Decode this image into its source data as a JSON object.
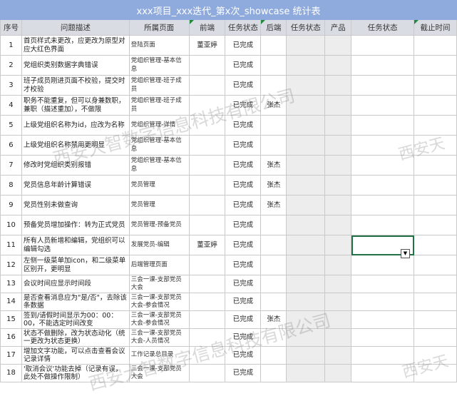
{
  "sheet": {
    "title": "xxx项目_xxx迭代_第x次_showcase 统计表",
    "headers": [
      "序号",
      "问题描述",
      "所属页面",
      "前端",
      "任务状态",
      "后端",
      "任务状态",
      "产品",
      "任务状态",
      "截止时间"
    ],
    "rows": [
      {
        "no": "1",
        "desc": "首页样式未更改，应更改为原型对应大红色界面",
        "page": "登陆页面",
        "fe": "董亚婷",
        "fs": "已完成",
        "be": "",
        "bs": "",
        "pm": "",
        "ps": "",
        "due": ""
      },
      {
        "no": "2",
        "desc": "党组织类别数据字典错误",
        "page": "党组织管理-基本信息",
        "fe": "",
        "fs": "已完成",
        "be": "",
        "bs": "",
        "pm": "",
        "ps": "",
        "due": ""
      },
      {
        "no": "3",
        "desc": "班子成员刚进页面不校验，提交时才校验",
        "page": "党组织管理-班子成员",
        "fe": "",
        "fs": "已完成",
        "be": "",
        "bs": "",
        "pm": "",
        "ps": "",
        "due": ""
      },
      {
        "no": "4",
        "desc": "职务不能重复，但可以身兼数职，兼职（描述重加），不做限",
        "page": "党组织管理-班子成员",
        "fe": "",
        "fs": "已完成",
        "be": "张杰",
        "bs": "",
        "pm": "",
        "ps": "",
        "due": ""
      },
      {
        "no": "5",
        "desc": "上级党组织名称为id，应改为名称",
        "page": "党组织管理-详情",
        "fe": "",
        "fs": "已完成",
        "be": "",
        "bs": "",
        "pm": "",
        "ps": "",
        "due": ""
      },
      {
        "no": "6",
        "desc": "上级党组织名称禁用更明显",
        "page": "党组织管理-基本信息",
        "fe": "",
        "fs": "已完成",
        "be": "",
        "bs": "",
        "pm": "",
        "ps": "",
        "due": ""
      },
      {
        "no": "7",
        "desc": "修改时党组织类别报错",
        "page": "党组织管理-基本信息",
        "fe": "",
        "fs": "已完成",
        "be": "张杰",
        "bs": "",
        "pm": "",
        "ps": "",
        "due": ""
      },
      {
        "no": "8",
        "desc": "党员信息年龄计算错误",
        "page": "党员管理",
        "fe": "",
        "fs": "已完成",
        "be": "张杰",
        "bs": "",
        "pm": "",
        "ps": "",
        "due": ""
      },
      {
        "no": "9",
        "desc": "党员性别未做查询",
        "page": "党员管理",
        "fe": "",
        "fs": "已完成",
        "be": "张杰",
        "bs": "",
        "pm": "",
        "ps": "",
        "due": ""
      },
      {
        "no": "10",
        "desc": "预备党员增加操作：转为正式党员",
        "page": "党员管理-预备党员",
        "fe": "",
        "fs": "已完成",
        "be": "",
        "bs": "",
        "pm": "",
        "ps": "",
        "due": ""
      },
      {
        "no": "11",
        "desc": "所有人员新增和编辑，党组织可以编辑勾选",
        "page": "发展党员-编辑",
        "fe": "董亚婷",
        "fs": "已完成",
        "be": "",
        "bs": "",
        "pm": "",
        "ps": "",
        "due": ""
      },
      {
        "no": "12",
        "desc": "左侧一级菜单加icon，和二级菜单区别开，更明显",
        "page": "后端管理页面",
        "fe": "",
        "fs": "已完成",
        "be": "",
        "bs": "",
        "pm": "",
        "ps": "",
        "due": ""
      },
      {
        "no": "13",
        "desc": "会议时间应显示时间段",
        "page": "三会一课-支部党员大会",
        "fe": "",
        "fs": "已完成",
        "be": "",
        "bs": "",
        "pm": "",
        "ps": "",
        "due": ""
      },
      {
        "no": "14",
        "desc": "是否查看消息应为\"是/否\"，去除该条数据",
        "page": "三会一课-支部党员大会-参会情况",
        "fe": "",
        "fs": "已完成",
        "be": "",
        "bs": "",
        "pm": "",
        "ps": "",
        "due": ""
      },
      {
        "no": "15",
        "desc": "签到/请假时间显示为00：00：00，不能选定时间改变",
        "page": "三会一课-支部党员大会-参会情况",
        "fe": "",
        "fs": "已完成",
        "be": "张杰",
        "bs": "",
        "pm": "",
        "ps": "",
        "due": ""
      },
      {
        "no": "16",
        "desc": "状态不做删除，改为状态动化（统一更改为状态更换）",
        "page": "三会一课-支部党员大会-人员情况",
        "fe": "",
        "fs": "已完成",
        "be": "",
        "bs": "",
        "pm": "",
        "ps": "",
        "due": ""
      },
      {
        "no": "17",
        "desc": "增加文字功能，可以点击查看会议记录详情",
        "page": "工作记录总目录",
        "fe": "",
        "fs": "已完成",
        "be": "",
        "bs": "",
        "pm": "",
        "ps": "",
        "due": ""
      },
      {
        "no": "18",
        "desc": "'取消会议'功能去掉（记录有误，此处不做操作限制）",
        "page": "三会一课-支部党员大会",
        "fe": "",
        "fs": "已完成",
        "be": "",
        "bs": "",
        "pm": "",
        "ps": "",
        "due": ""
      }
    ],
    "dropdown_arrow": "▼"
  },
  "watermark": {
    "text_a": "西安大智数字信息科技有限公司",
    "text_b": "西安天"
  }
}
